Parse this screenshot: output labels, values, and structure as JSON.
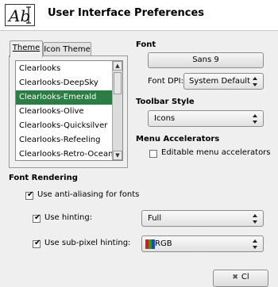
{
  "window": {
    "title": "User Interface Preferences",
    "app_icon": "ab-text-icon"
  },
  "tabs": [
    {
      "label": "Theme",
      "active": true
    },
    {
      "label": "Icon Theme",
      "active": false
    }
  ],
  "theme_list": {
    "items": [
      "Clearlooks",
      "Clearlooks-DeepSky",
      "Clearlooks-Emerald",
      "Clearlooks-Olive",
      "Clearlooks-Quicksilver",
      "Clearlooks-Refeeling",
      "Clearlooks-Retro-Ocean"
    ],
    "selected": "Clearlooks-Emerald"
  },
  "font": {
    "heading": "Font",
    "button_label": "Sans 9",
    "dpi_label": "Font DPI:",
    "dpi_value": "System Default"
  },
  "toolbar_style": {
    "heading": "Toolbar Style",
    "value": "Icons"
  },
  "menu_accelerators": {
    "heading": "Menu Accelerators",
    "editable_label": "Editable menu accelerators",
    "editable_checked": false
  },
  "font_rendering": {
    "heading": "Font Rendering",
    "anti_aliasing_label": "Use anti-aliasing for fonts",
    "anti_aliasing_checked": true,
    "hinting_label": "Use hinting:",
    "hinting_checked": true,
    "hinting_value": "Full",
    "subpixel_label": "Use sub-pixel hinting:",
    "subpixel_checked": true,
    "subpixel_value": "RGB"
  },
  "footer": {
    "close_label": "Cl"
  },
  "colors": {
    "selection": "#2c7c46",
    "subpixel_r": "#d02020",
    "subpixel_g": "#20a020",
    "subpixel_b": "#2040d0"
  }
}
